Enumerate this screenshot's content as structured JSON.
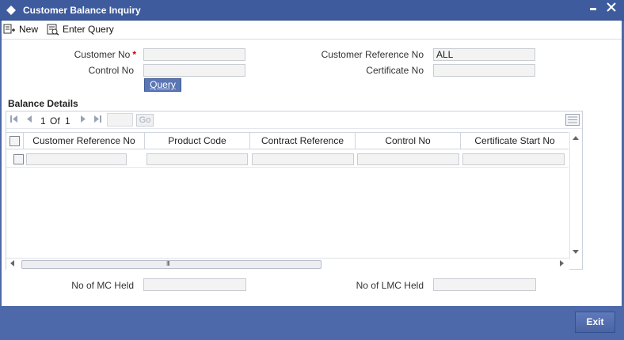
{
  "window": {
    "title": "Customer Balance Inquiry",
    "minimize": "▬",
    "close": "✕"
  },
  "toolbar": {
    "new_label": "New",
    "enter_query_label": "Enter Query"
  },
  "form": {
    "customer_no_label": "Customer No",
    "customer_no_required": "*",
    "customer_no_value": "",
    "control_no_label": "Control No",
    "control_no_value": "",
    "customer_ref_label": "Customer Reference No",
    "customer_ref_value": "ALL",
    "certificate_no_label": "Certificate No",
    "certificate_no_value": "",
    "query_button": "Query"
  },
  "balance_details": {
    "title": "Balance Details",
    "pager": {
      "current": "1",
      "of_label": "Of",
      "total": "1",
      "go_label": "Go",
      "page_input": ""
    },
    "columns": [
      "Customer Reference No",
      "Product Code",
      "Contract Reference",
      "Control No",
      "Certificate Start No"
    ],
    "rows": [
      [
        "",
        "",
        "",
        "",
        ""
      ]
    ],
    "scroll_grip": "III"
  },
  "summary": {
    "mc_held_label": "No of MC Held",
    "mc_held_value": "",
    "lmc_held_label": "No of LMC Held",
    "lmc_held_value": ""
  },
  "footer": {
    "exit_label": "Exit"
  },
  "colors": {
    "frame": "#4d69a9",
    "titlebar": "#3d5b9d",
    "required": "#cc0000"
  }
}
